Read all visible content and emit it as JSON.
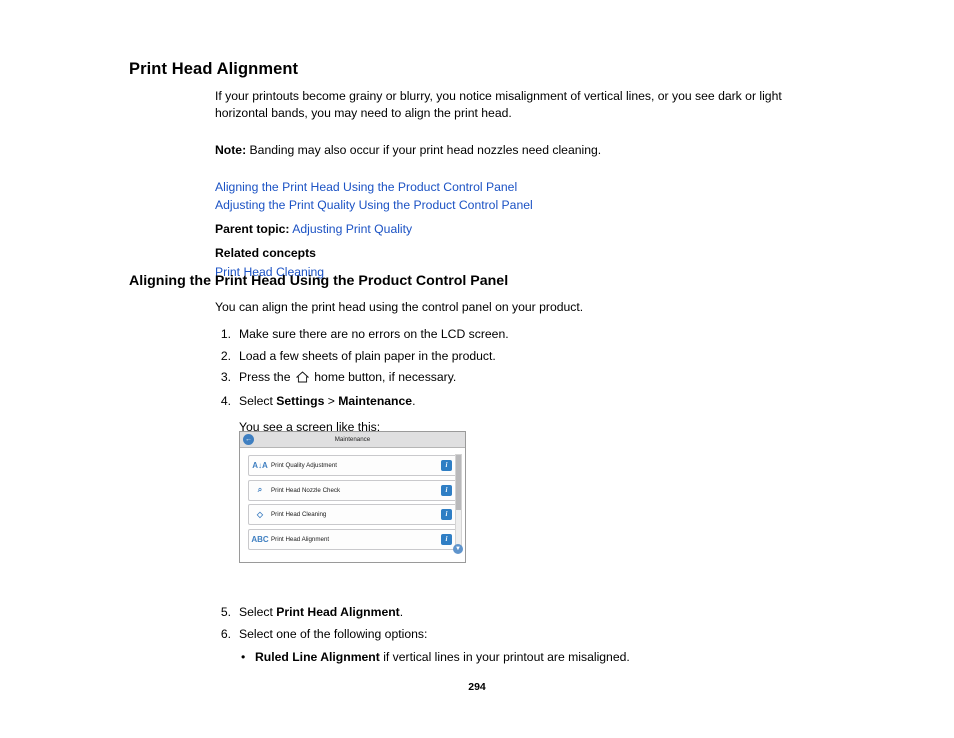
{
  "document": {
    "title": "Print Head Alignment",
    "intro": "If your printouts become grainy or blurry, you notice misalignment of vertical lines, or you see dark or light horizontal bands, you may need to align the print head.",
    "note_label": "Note:",
    "note_text": " Banding may also occur if your print head nozzles need cleaning.",
    "links": [
      "Aligning the Print Head Using the Product Control Panel",
      "Adjusting the Print Quality Using the Product Control Panel"
    ],
    "parent_topic_label": "Parent topic:",
    "parent_topic_link": "Adjusting Print Quality",
    "related_concepts_label": "Related concepts",
    "related_concepts_link": "Print Head Cleaning",
    "page_number": "294"
  },
  "section": {
    "heading": "Aligning the Print Head Using the Product Control Panel",
    "lead": "You can align the print head using the control panel on your product.",
    "steps": [
      {
        "num": "1.",
        "text": "Make sure there are no errors on the LCD screen."
      },
      {
        "num": "2.",
        "text": "Load a few sheets of plain paper in the product."
      },
      {
        "num": "3.",
        "pre": "Press the ",
        "icon": "home-icon",
        "post": " home button, if necessary."
      },
      {
        "num": "4.",
        "pre": "Select ",
        "bold1": "Settings",
        "mid": " > ",
        "bold2": "Maintenance",
        "post": "."
      }
    ],
    "see_screen": "You see a screen like this:",
    "steps_after": [
      {
        "num": "5.",
        "pre": "Select ",
        "bold1": "Print Head Alignment",
        "post": "."
      },
      {
        "num": "6.",
        "text": "Select one of the following options:"
      }
    ],
    "bullet": {
      "dot": "•",
      "bold": "Ruled Line Alignment",
      "rest": " if vertical lines in your printout are misaligned."
    }
  },
  "lcd": {
    "back_icon": "←",
    "title": "Maintenance",
    "rows": [
      {
        "icon": "A↓A",
        "label": "Print Quality Adjustment",
        "info": "i"
      },
      {
        "icon": "⌕",
        "label": "Print Head Nozzle Check",
        "info": "i"
      },
      {
        "icon": "◇",
        "label": "Print Head Cleaning",
        "info": "i"
      },
      {
        "icon": "ABC",
        "label": "Print Head Alignment",
        "info": "i"
      }
    ],
    "scroll_down_icon": "▼"
  },
  "colors": {
    "link": "#1b52c4",
    "lcd_accent": "#2f7ec4"
  }
}
